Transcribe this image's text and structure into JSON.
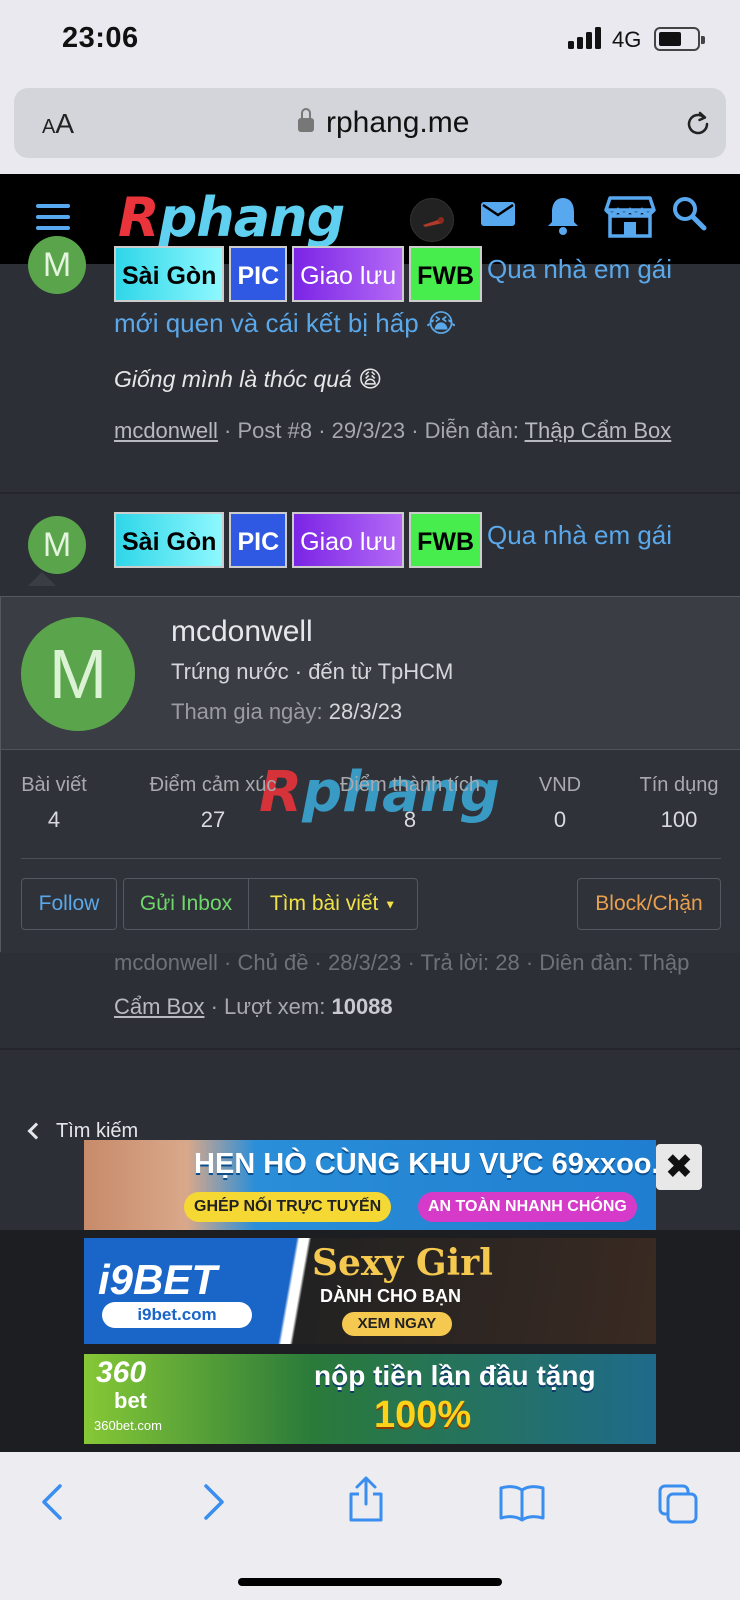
{
  "status_bar": {
    "time": "23:06",
    "network": "4G"
  },
  "browser": {
    "text_size_label_small": "A",
    "text_size_label_large": "A",
    "url": "rphang.me"
  },
  "site": {
    "logo_r": "R",
    "logo_rest": "phang"
  },
  "tags": {
    "saigon": "Sài Gòn",
    "pic": "PIC",
    "giaoluu": "Giao lưu",
    "fwb": "FWB"
  },
  "post1": {
    "avatar_letter": "M",
    "title_line1": "Qua nhà em gái",
    "title_line2": "mới quen và cái kết bị hấp 😭",
    "snippet": "Giống mình là thóc quá 😩",
    "author": "mcdonwell",
    "post_no": "Post #8",
    "date": "29/3/23",
    "forum_label": "Diễn đàn:",
    "forum": "Thập Cẩm Box"
  },
  "post2": {
    "avatar_letter": "M",
    "title_line1": "Qua nhà em gái",
    "meta_partial": "mcdonwell · Chủ đề · 28/3/23 · Trả lời: 28 · Diễn đàn: Thập",
    "forum_cont": "Cẩm Box",
    "views_label": "· Lượt xem:",
    "views": "10088"
  },
  "popup": {
    "avatar_letter": "M",
    "username": "mcdonwell",
    "user_title": "Trứng nước · đến từ TpHCM",
    "joined_label": "Tham gia ngày:",
    "joined_date": "28/3/23",
    "stats": [
      {
        "label": "Bài viết",
        "value": "4"
      },
      {
        "label": "Điểm cảm xúc",
        "value": "27"
      },
      {
        "label": "Điểm thành tích",
        "value": "8"
      },
      {
        "label": "VND",
        "value": "0"
      },
      {
        "label": "Tín dụng",
        "value": "100"
      }
    ],
    "buttons": {
      "follow": "Follow",
      "inbox": "Gửi Inbox",
      "find_posts": "Tìm bài viết",
      "block": "Block/Chặn"
    }
  },
  "back_link": "Tìm kiếm",
  "ads": [
    {
      "line1": "HẸN HÒ CÙNG KHU VỰC 69xxoo.cc",
      "pill1": "GHÉP NỐI TRỰC TUYẾN",
      "pill2": "AN TOÀN NHANH CHÓNG"
    },
    {
      "brand": "i9BET",
      "domain": "i9bet.com",
      "headline": "Sexy Girl",
      "sub": "DÀNH CHO BẠN",
      "cta": "XEM NGAY"
    },
    {
      "brand": "360",
      "brand_sub": "bet",
      "domain": "360bet.com",
      "line1": "nộp tiền lần đầu tặng",
      "line2": "100%"
    }
  ],
  "close_ad_label": "✖",
  "colors": {
    "link": "#5aa8ea",
    "follow": "#5aa8ea",
    "inbox": "#6fd86a",
    "find": "#f2e24a",
    "block": "#e8a050",
    "avatar": "#5aa54c"
  }
}
